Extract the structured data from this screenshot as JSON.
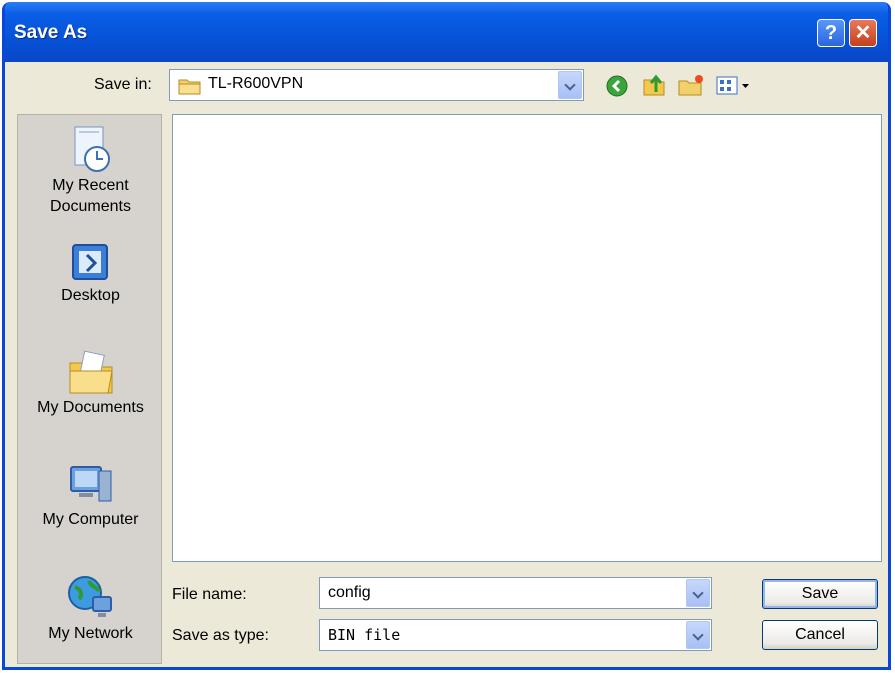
{
  "window": {
    "title": "Save As"
  },
  "titlebar": {
    "help_glyph": "?",
    "close_glyph": "✕"
  },
  "toolbar": {
    "save_in_label": "Save in:",
    "folder": "TL-R600VPN",
    "icons": [
      "back-icon",
      "up-folder-icon",
      "new-folder-icon",
      "view-menu-icon"
    ]
  },
  "places": [
    {
      "label_line1": "My Recent",
      "label_line2": "Documents",
      "icon": "recent-documents-icon"
    },
    {
      "label_line1": "Desktop",
      "label_line2": "",
      "icon": "desktop-icon"
    },
    {
      "label_line1": "My Documents",
      "label_line2": "",
      "icon": "my-documents-icon"
    },
    {
      "label_line1": "My Computer",
      "label_line2": "",
      "icon": "my-computer-icon"
    },
    {
      "label_line1": "My Network",
      "label_line2": "",
      "icon": "my-network-icon"
    }
  ],
  "form": {
    "file_name_label": "File name:",
    "file_name_value": "config",
    "save_type_label": "Save as type:",
    "save_type_value": "BIN file"
  },
  "buttons": {
    "save": "Save",
    "cancel": "Cancel"
  },
  "colors": {
    "titlebar": "#0653d8",
    "dialog_bg": "#ece9d8",
    "close": "#c4401e"
  }
}
